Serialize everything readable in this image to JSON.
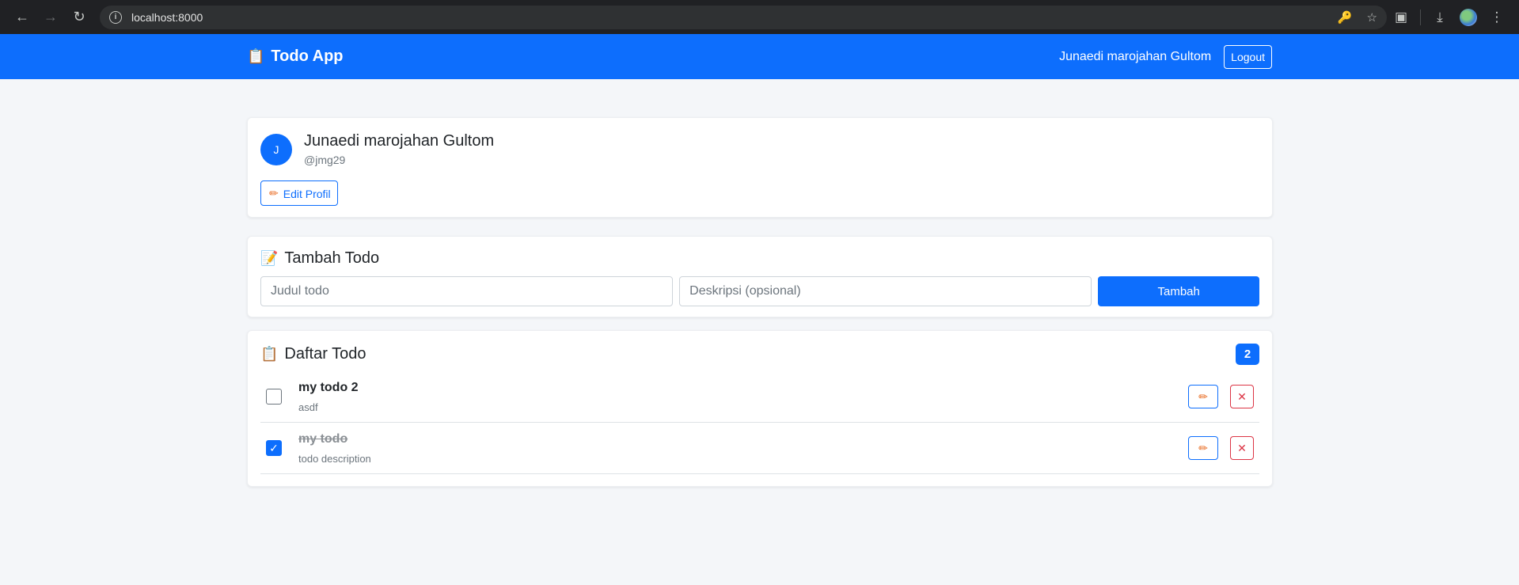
{
  "browser": {
    "url": "localhost:8000"
  },
  "navbar": {
    "brand_icon": "📋",
    "brand": "Todo App",
    "user_name": "Junaedi marojahan Gultom",
    "logout_label": "Logout"
  },
  "profile": {
    "avatar_initial": "J",
    "name": "Junaedi marojahan Gultom",
    "username": "@jmg29",
    "edit_label": "Edit Profil"
  },
  "add_todo": {
    "icon": "📝",
    "title": "Tambah Todo",
    "title_placeholder": "Judul todo",
    "desc_placeholder": "Deskripsi (opsional)",
    "submit_label": "Tambah"
  },
  "todo_list": {
    "icon": "📋",
    "title": "Daftar Todo",
    "count": "2",
    "items": [
      {
        "title": "my todo 2",
        "description": "asdf",
        "completed": false
      },
      {
        "title": "my todo",
        "description": "todo description",
        "completed": true
      }
    ]
  },
  "colors": {
    "primary": "#0d6efd",
    "danger": "#dc3545",
    "pencil": "#e8681d",
    "background": "#f4f6f9"
  }
}
